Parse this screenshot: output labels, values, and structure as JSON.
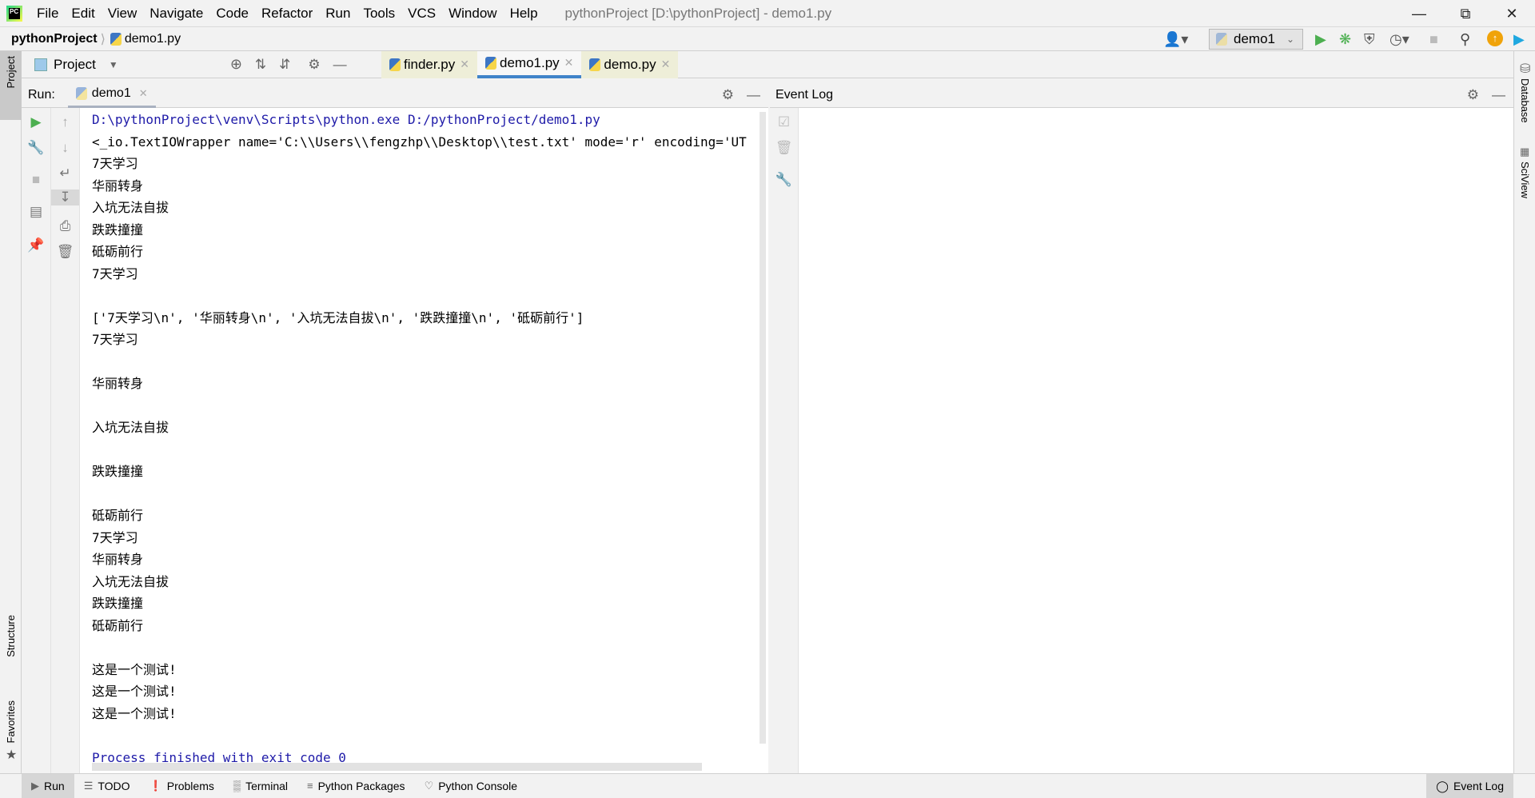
{
  "menu": [
    "File",
    "Edit",
    "View",
    "Navigate",
    "Code",
    "Refactor",
    "Run",
    "Tools",
    "VCS",
    "Window",
    "Help"
  ],
  "window_title": "pythonProject [D:\\pythonProject] - demo1.py",
  "logo_text": "PC",
  "breadcrumb": {
    "project": "pythonProject",
    "file": "demo1.py"
  },
  "run_config": "demo1",
  "project_view": "Project",
  "file_tabs": [
    {
      "label": "finder.py"
    },
    {
      "label": "demo1.py",
      "active": true
    },
    {
      "label": "demo.py"
    }
  ],
  "run_panel": {
    "label": "Run:",
    "tab": "demo1"
  },
  "console_lines": [
    {
      "t": "D:\\pythonProject\\venv\\Scripts\\python.exe D:/pythonProject/demo1.py",
      "s": "sys"
    },
    {
      "t": "<_io.TextIOWrapper name='C:\\\\Users\\\\fengzhp\\\\Desktop\\\\test.txt' mode='r' encoding='UT"
    },
    {
      "t": "7天学习"
    },
    {
      "t": "华丽转身"
    },
    {
      "t": "入坑无法自拔"
    },
    {
      "t": "跌跌撞撞"
    },
    {
      "t": "砥砺前行"
    },
    {
      "t": "7天学习"
    },
    {
      "t": ""
    },
    {
      "t": "['7天学习\\n', '华丽转身\\n', '入坑无法自拔\\n', '跌跌撞撞\\n', '砥砺前行']"
    },
    {
      "t": "7天学习"
    },
    {
      "t": ""
    },
    {
      "t": "华丽转身"
    },
    {
      "t": ""
    },
    {
      "t": "入坑无法自拔"
    },
    {
      "t": ""
    },
    {
      "t": "跌跌撞撞"
    },
    {
      "t": ""
    },
    {
      "t": "砥砺前行"
    },
    {
      "t": "7天学习"
    },
    {
      "t": "华丽转身"
    },
    {
      "t": "入坑无法自拔"
    },
    {
      "t": "跌跌撞撞"
    },
    {
      "t": "砥砺前行"
    },
    {
      "t": ""
    },
    {
      "t": "这是一个测试!"
    },
    {
      "t": "这是一个测试!"
    },
    {
      "t": "这是一个测试!"
    },
    {
      "t": ""
    },
    {
      "t": "Process finished with exit code 0",
      "s": "sys"
    }
  ],
  "event_log": {
    "title": "Event Log"
  },
  "left_strip": {
    "project": "Project",
    "structure": "Structure",
    "favorites": "Favorites"
  },
  "right_strip": {
    "database": "Database",
    "sciview": "SciView"
  },
  "bottom_tabs": [
    "Run",
    "TODO",
    "Problems",
    "Terminal",
    "Python Packages",
    "Python Console"
  ],
  "bottom_event_log": "Event Log"
}
